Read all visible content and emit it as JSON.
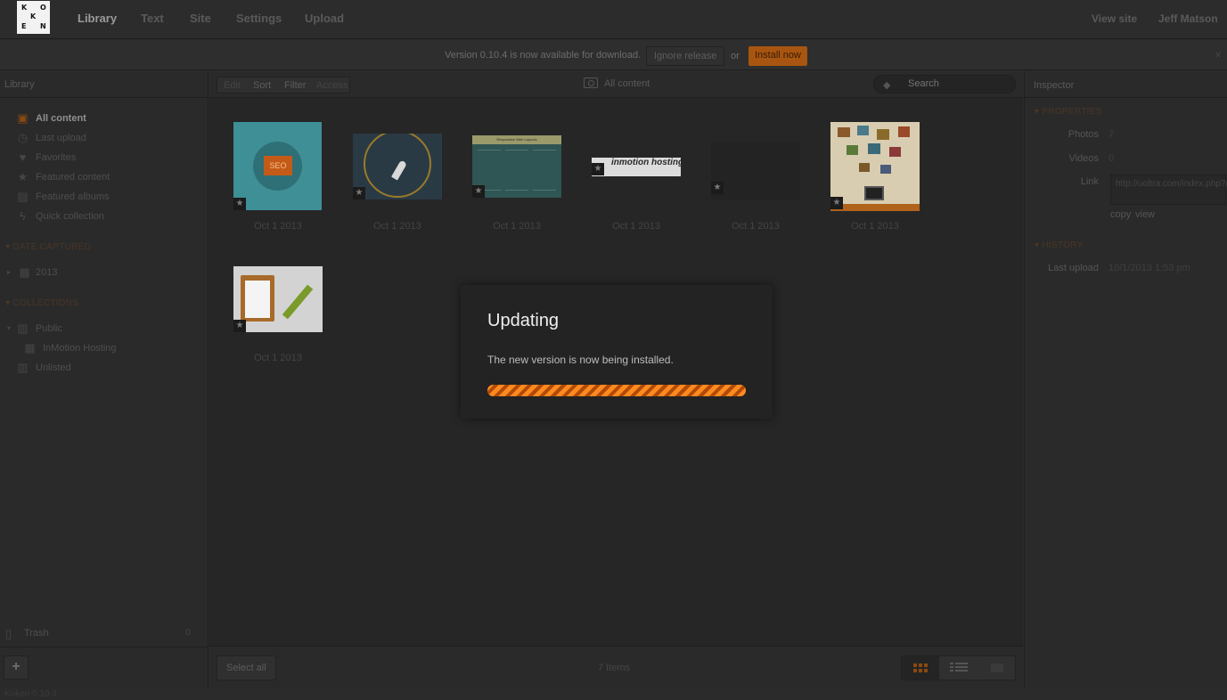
{
  "app": {
    "logo_letters": [
      "K",
      "O",
      "K",
      "E",
      "N"
    ],
    "nav": [
      "Library",
      "Text",
      "Site",
      "Settings",
      "Upload"
    ],
    "active_nav": "Library",
    "view_site": "View site",
    "user": "Jeff Matson"
  },
  "banner": {
    "message": "Version 0.10.4 is now available for download.",
    "ignore_label": "Ignore release",
    "or_text": "or",
    "install_label": "Install now",
    "close": "×"
  },
  "sidebar": {
    "title": "Library",
    "items": [
      {
        "label": "All content",
        "icon": "camera-icon",
        "glyph": "▣"
      },
      {
        "label": "Last upload",
        "icon": "clock-icon",
        "glyph": "◷"
      },
      {
        "label": "Favorites",
        "icon": "heart-icon",
        "glyph": "♥"
      },
      {
        "label": "Featured content",
        "icon": "star-icon",
        "glyph": "★"
      },
      {
        "label": "Featured albums",
        "icon": "album-star-icon",
        "glyph": "▤"
      },
      {
        "label": "Quick collection",
        "icon": "lightning-icon",
        "glyph": "ϟ"
      }
    ],
    "date_section": "DATE CAPTURED",
    "year": "2013",
    "collections_section": "COLLECTIONS",
    "public": "Public",
    "album": "InMotion Hosting",
    "unlisted": "Unlisted",
    "trash_label": "Trash",
    "trash_count": "0",
    "add": "+"
  },
  "toolbar": {
    "tabs": [
      "Edit",
      "Sort",
      "Filter",
      "Access"
    ],
    "crumb": "All content",
    "search_placeholder": "Search"
  },
  "thumbnails": [
    {
      "date": "Oct 1 2013",
      "title": "SEO"
    },
    {
      "date": "Oct 1 2013",
      "title": ""
    },
    {
      "date": "Oct 1 2013",
      "title": "Responsive Web Layouts"
    },
    {
      "date": "Oct 1 2013",
      "title": "inmotion hosting"
    },
    {
      "date": "Oct 1 2013",
      "title": ""
    },
    {
      "date": "Oct 1 2013",
      "title": ""
    },
    {
      "date": "Oct 1 2013",
      "title": ""
    }
  ],
  "footer": {
    "select_all": "Select all",
    "count": "7 Items"
  },
  "inspector": {
    "title": "Inspector",
    "properties_section": "PROPERTIES",
    "photos_label": "Photos",
    "photos_value": "7",
    "videos_label": "Videos",
    "videos_value": "0",
    "link_label": "Link",
    "link_value": "http://uoltra.com/index.php?/content/",
    "copy": "copy",
    "view": "view",
    "history_section": "HISTORY",
    "last_upload_label": "Last upload",
    "last_upload_value": "10/1/2013 1:53 pm"
  },
  "version_footer": "Koken 0.10.4",
  "modal": {
    "title": "Updating",
    "message": "The new version is now being installed.",
    "progress": 1.0
  },
  "colors": {
    "accent": "#f07a14",
    "overlay": "#262626"
  }
}
